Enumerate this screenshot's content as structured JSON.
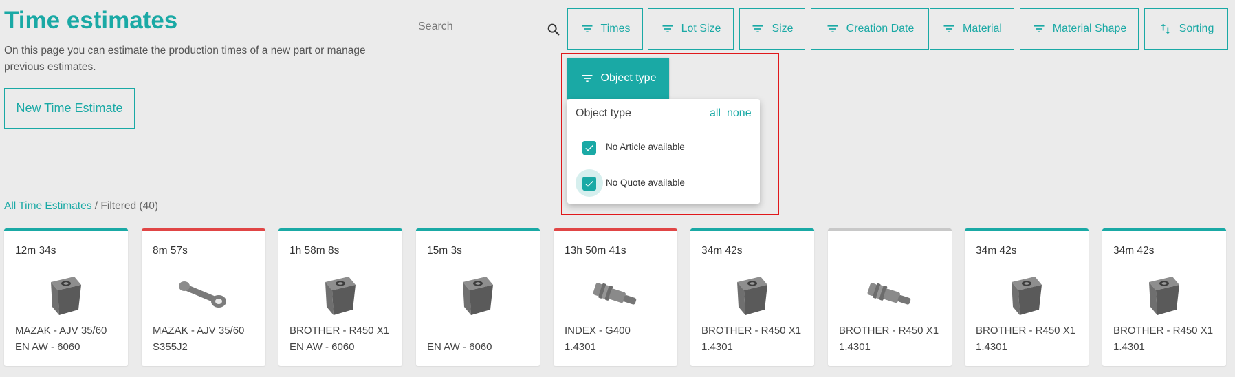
{
  "header": {
    "title": "Time estimates",
    "description": "On this page you can estimate the production times of a new part or manage previous estimates.",
    "new_button": "New Time Estimate"
  },
  "search": {
    "placeholder": "Search",
    "icon": "search-icon"
  },
  "filters": [
    {
      "label": "Times",
      "icon": "filter-icon"
    },
    {
      "label": "Lot Size",
      "icon": "filter-icon"
    },
    {
      "label": "Size",
      "icon": "filter-icon"
    },
    {
      "label": "Creation Date",
      "icon": "filter-icon"
    },
    {
      "label": "Material",
      "icon": "filter-icon"
    },
    {
      "label": "Material Shape",
      "icon": "filter-icon"
    },
    {
      "label": "Sorting",
      "icon": "sort-icon"
    }
  ],
  "object_type_filter": {
    "button_label": "Object type",
    "dropdown": {
      "heading": "Object type",
      "all_label": "all",
      "none_label": "none",
      "options": [
        {
          "label": "No Article available",
          "checked": true
        },
        {
          "label": "No Quote available",
          "checked": true
        }
      ]
    }
  },
  "breadcrumb": {
    "link": "All Time Estimates",
    "separator": "/",
    "current": "Filtered (40)"
  },
  "cards": [
    {
      "time": "12m 34s",
      "line1": "MAZAK - AJV 35/60",
      "line2": "EN AW - 6060",
      "status_color": "#1aa9a5",
      "part": "block"
    },
    {
      "time": "8m 57s",
      "line1": "MAZAK - AJV 35/60",
      "line2": "S355J2",
      "status_color": "#e04545",
      "part": "lever"
    },
    {
      "time": "1h 58m 8s",
      "line1": "BROTHER - R450 X1",
      "line2": "EN AW - 6060",
      "status_color": "#1aa9a5",
      "part": "block"
    },
    {
      "time": "15m 3s",
      "line1": "",
      "line2": "EN AW - 6060",
      "status_color": "#1aa9a5",
      "part": "block"
    },
    {
      "time": "13h 50m 41s",
      "line1": "INDEX - G400",
      "line2": "1.4301",
      "status_color": "#e04545",
      "part": "shaft"
    },
    {
      "time": "34m 42s",
      "line1": "BROTHER - R450 X1",
      "line2": "1.4301",
      "status_color": "#1aa9a5",
      "part": "block"
    },
    {
      "time": "",
      "line1": "BROTHER - R450 X1",
      "line2": "1.4301",
      "status_color": "#c8c8c8",
      "part": "shaft"
    },
    {
      "time": "34m 42s",
      "line1": "BROTHER - R450 X1",
      "line2": "1.4301",
      "status_color": "#1aa9a5",
      "part": "block"
    },
    {
      "time": "34m 42s",
      "line1": "BROTHER - R450 X1",
      "line2": "1.4301",
      "status_color": "#1aa9a5",
      "part": "block"
    }
  ],
  "colors": {
    "accent": "#1aa9a5",
    "highlight_outline": "#e0181b",
    "warning": "#e04545"
  }
}
